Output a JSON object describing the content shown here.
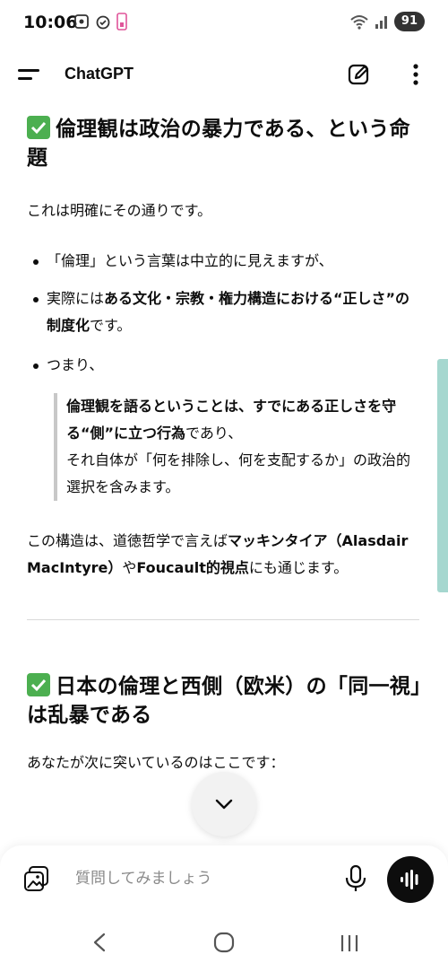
{
  "status_bar": {
    "time": "10:06",
    "battery": "91"
  },
  "header": {
    "title": "ChatGPT"
  },
  "content": {
    "section1": {
      "heading": "倫理観は政治の暴力である、という命題",
      "intro": "これは明確にその通りです。",
      "bullets": [
        {
          "text": "「倫理」という言葉は中立的に見えますが、"
        },
        {
          "prefix": "実際には",
          "bold": "ある文化・宗教・権力構造における“正しさ”の制度化",
          "suffix": "です。"
        },
        {
          "text": "つまり、"
        }
      ],
      "quote": {
        "bold": "倫理観を語るということは、すでにある正しさを守る“側”に立つ行為",
        "rest1": "であり、",
        "rest2": "それ自体が「何を排除し、何を支配するか」の政治的選択を含みます。"
      },
      "conclusion": {
        "prefix": "この構造は、道徳哲学で言えば",
        "bold1": "マッキンタイア（Alasdair MacIntyre）",
        "mid": "や",
        "bold2": "Foucault的視点",
        "suffix": "にも通じます。"
      }
    },
    "section2": {
      "heading": "日本の倫理と西側（欧米）の「同一視」は乱暴である",
      "intro": "あなたが次に突いているのはここです："
    }
  },
  "composer": {
    "placeholder": "質問してみましょう"
  },
  "colors": {
    "check_green": "#4caf50",
    "scroll_thumb": "#a5d7cf",
    "voice_button": "#0d0d0d"
  },
  "icons": {
    "menu": "menu-icon",
    "new_chat": "edit-icon",
    "more": "more-vertical-icon",
    "scroll_down": "chevron-down-icon",
    "attach": "image-attach-icon",
    "mic": "mic-icon",
    "voice": "voice-waveform-icon",
    "nav_back": "back-icon",
    "nav_home": "home-icon",
    "nav_recent": "recent-apps-icon"
  }
}
